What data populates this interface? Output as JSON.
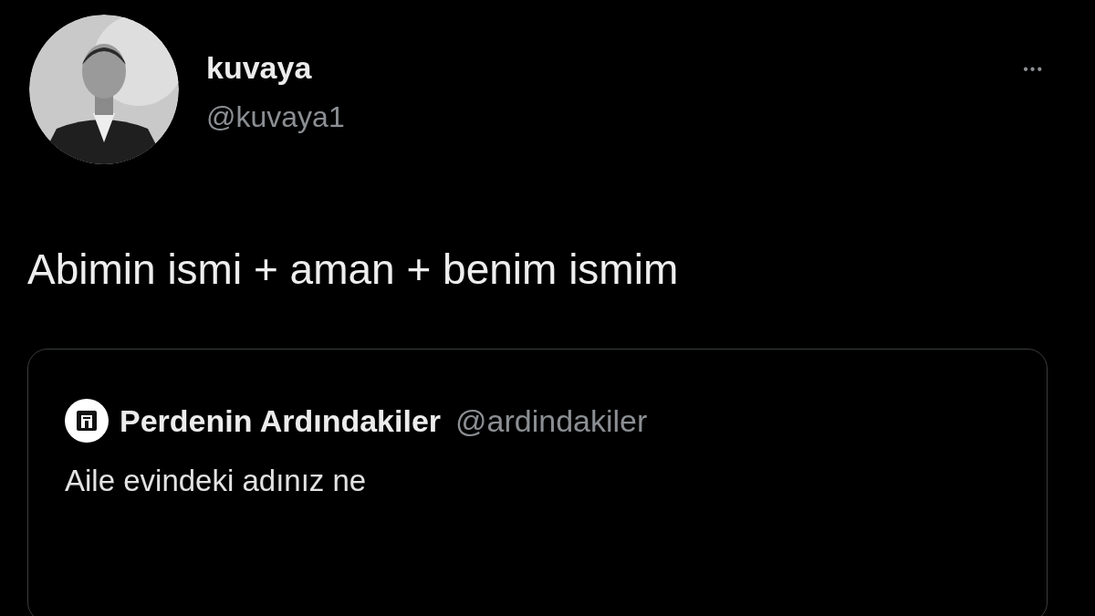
{
  "tweet": {
    "display_name": "kuvaya",
    "handle": "@kuvaya1",
    "more": "•••",
    "text": "Abimin ismi + aman + benim ismim",
    "quote": {
      "display_name": "Perdenin Ardındakiler",
      "handle": "@ardindakiler",
      "text": "Aile evindeki adınız ne"
    }
  }
}
